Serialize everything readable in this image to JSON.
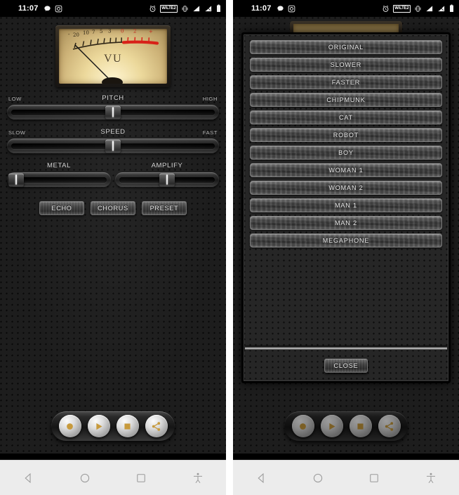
{
  "status_bar": {
    "time": "11:07",
    "left_icons": [
      "message-icon",
      "camera-icon"
    ],
    "right_icons": [
      "alarm-icon",
      "network-badge",
      "vibrate-icon",
      "signal-icon",
      "signal-2-icon",
      "battery-icon"
    ],
    "network_label": "W/LTE2"
  },
  "vu_meter": {
    "label": "VU",
    "scale_marks": [
      "-",
      "20",
      "10",
      "7",
      "5",
      "3",
      "0",
      "2",
      "+"
    ],
    "red_zone_start": "0",
    "needle_value": "-20"
  },
  "sliders": [
    {
      "name": "pitch",
      "title": "PITCH",
      "left_label": "LOW",
      "right_label": "HIGH",
      "value": 50
    },
    {
      "name": "speed",
      "title": "SPEED",
      "left_label": "SLOW",
      "right_label": "FAST",
      "value": 50
    }
  ],
  "small_sliders": [
    {
      "name": "metal",
      "title": "METAL",
      "value": 5
    },
    {
      "name": "amplify",
      "title": "AMPLIFY",
      "value": 50
    }
  ],
  "effect_buttons": [
    {
      "name": "echo",
      "label": "ECHO"
    },
    {
      "name": "chorus",
      "label": "CHORUS"
    },
    {
      "name": "preset",
      "label": "PRESET"
    }
  ],
  "transport": [
    {
      "name": "record",
      "icon": "record-icon"
    },
    {
      "name": "play",
      "icon": "play-icon"
    },
    {
      "name": "stop",
      "icon": "stop-icon"
    },
    {
      "name": "share",
      "icon": "share-icon"
    }
  ],
  "nav_bar": [
    {
      "name": "back",
      "icon": "back-triangle-icon"
    },
    {
      "name": "home",
      "icon": "home-circle-icon"
    },
    {
      "name": "recents",
      "icon": "recents-square-icon"
    },
    {
      "name": "accessibility",
      "icon": "accessibility-icon"
    }
  ],
  "preset_dialog": {
    "items": [
      {
        "label": "ORIGINAL"
      },
      {
        "label": "SLOWER"
      },
      {
        "label": "FASTER"
      },
      {
        "label": "CHIPMUNK"
      },
      {
        "label": "CAT"
      },
      {
        "label": "ROBOT"
      },
      {
        "label": "BOY"
      },
      {
        "label": "WOMAN 1"
      },
      {
        "label": "WOMAN 2"
      },
      {
        "label": "MAN 1"
      },
      {
        "label": "MAN 2"
      },
      {
        "label": "MEGAPHONE"
      }
    ],
    "close_label": "CLOSE"
  },
  "colors": {
    "accent_gold": "#c79a3c",
    "vu_face": "#ecd89a",
    "vu_red": "#d81f16",
    "panel_bg": "#1d1d1d",
    "nav_bg": "#ececec"
  }
}
